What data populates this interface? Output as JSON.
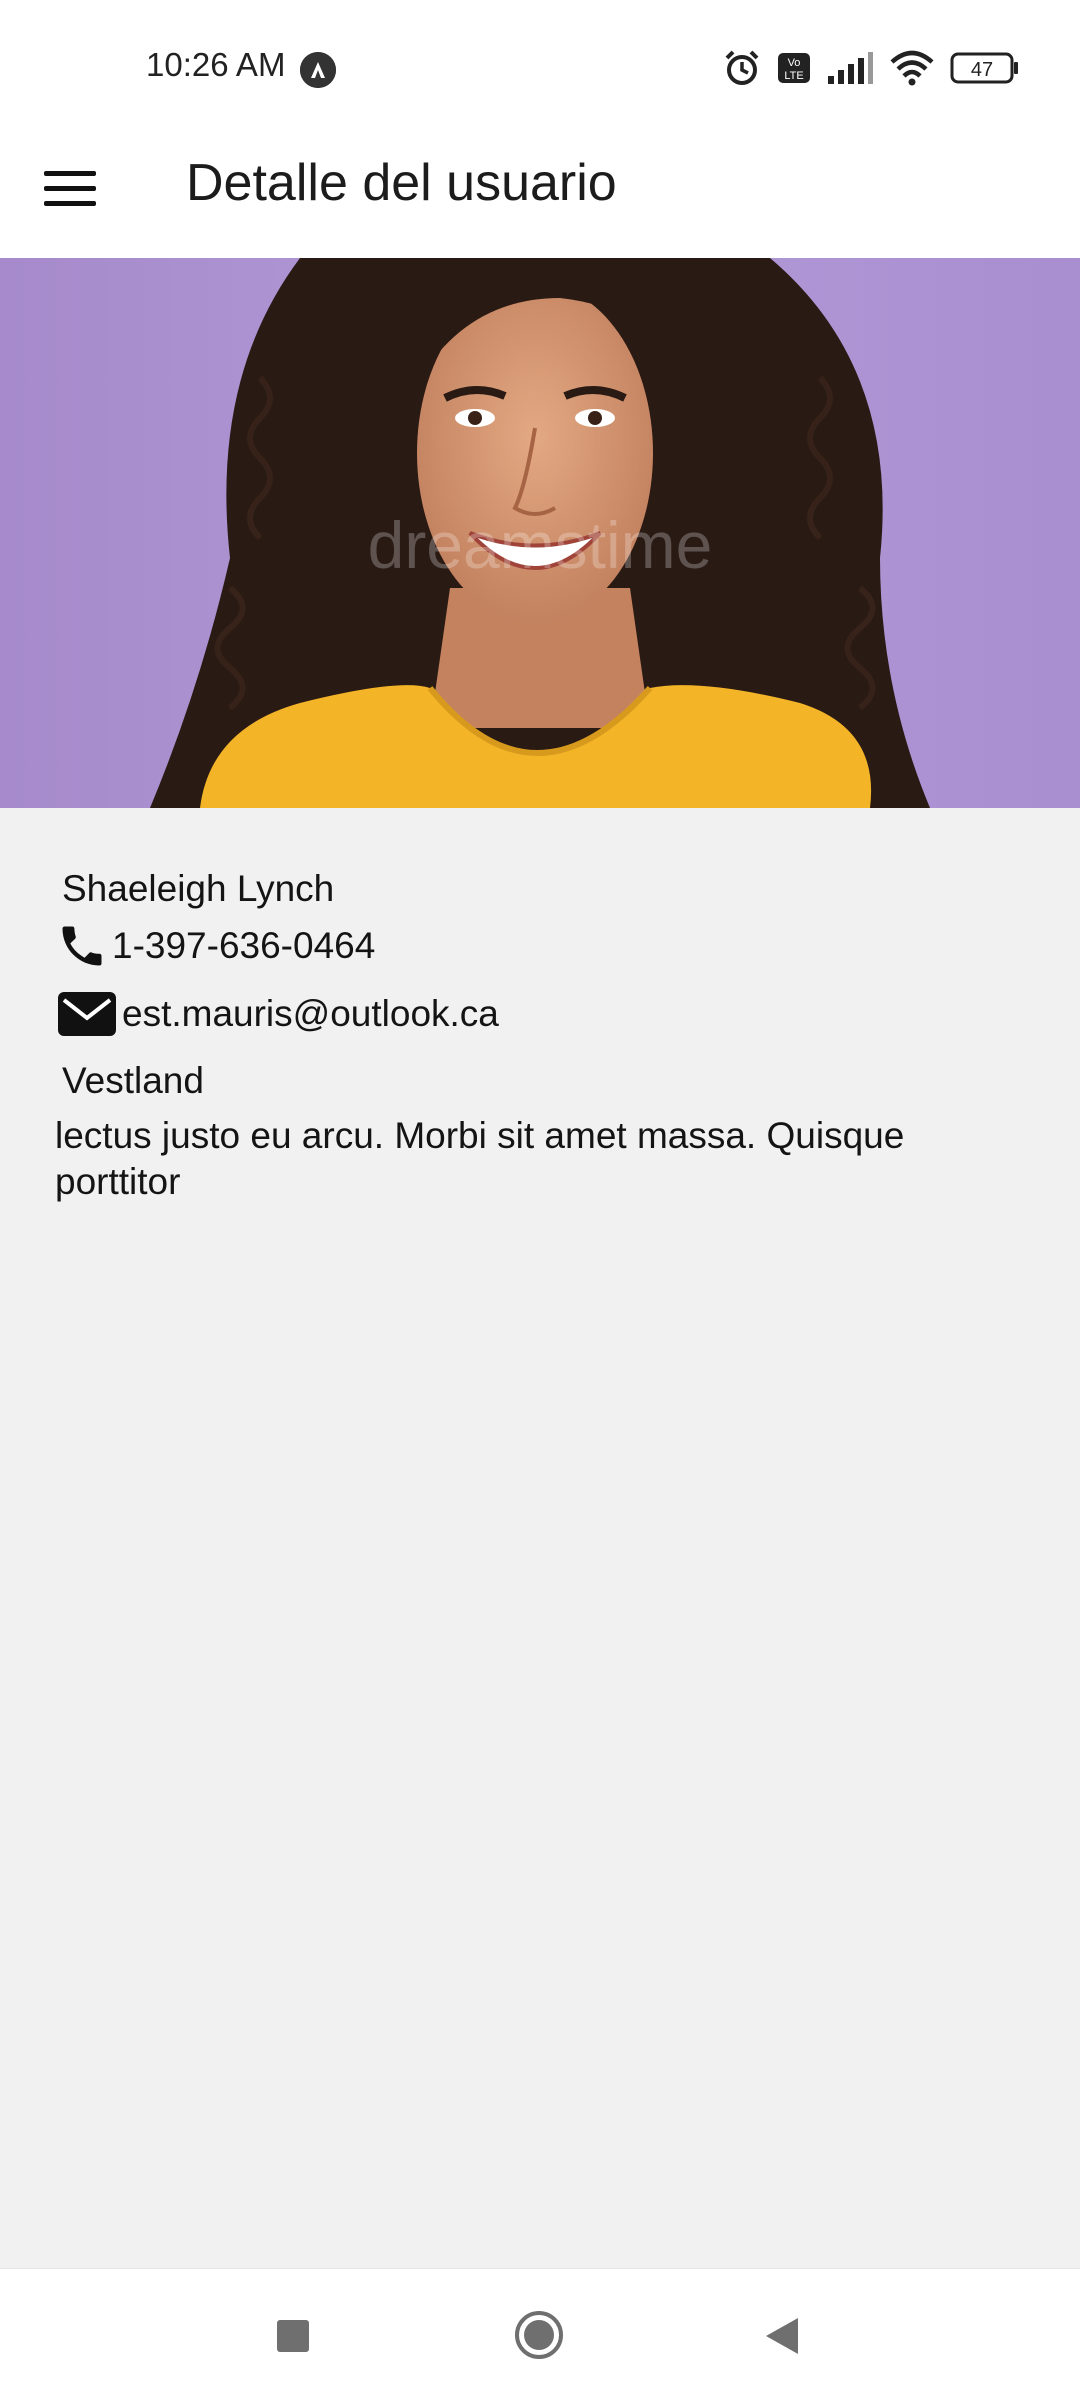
{
  "status_bar": {
    "time": "10:26 AM",
    "battery": "47",
    "icons": [
      "alarm-icon",
      "volte-icon",
      "signal-icon",
      "wifi-icon",
      "battery-icon"
    ]
  },
  "app_bar": {
    "title": "Detalle del usuario",
    "menu_icon": "hamburger-menu-icon"
  },
  "hero": {
    "watermark": "dreamstime",
    "background_color": "#ae96d4"
  },
  "user": {
    "name": "Shaeleigh Lynch",
    "phone": "1-397-636-0464",
    "email": "est.mauris@outlook.ca",
    "region": "Vestland",
    "description": "lectus justo eu arcu. Morbi sit amet massa. Quisque porttitor"
  },
  "nav_bar": {
    "icons": [
      "recents-square-icon",
      "home-circle-icon",
      "back-triangle-icon"
    ]
  }
}
